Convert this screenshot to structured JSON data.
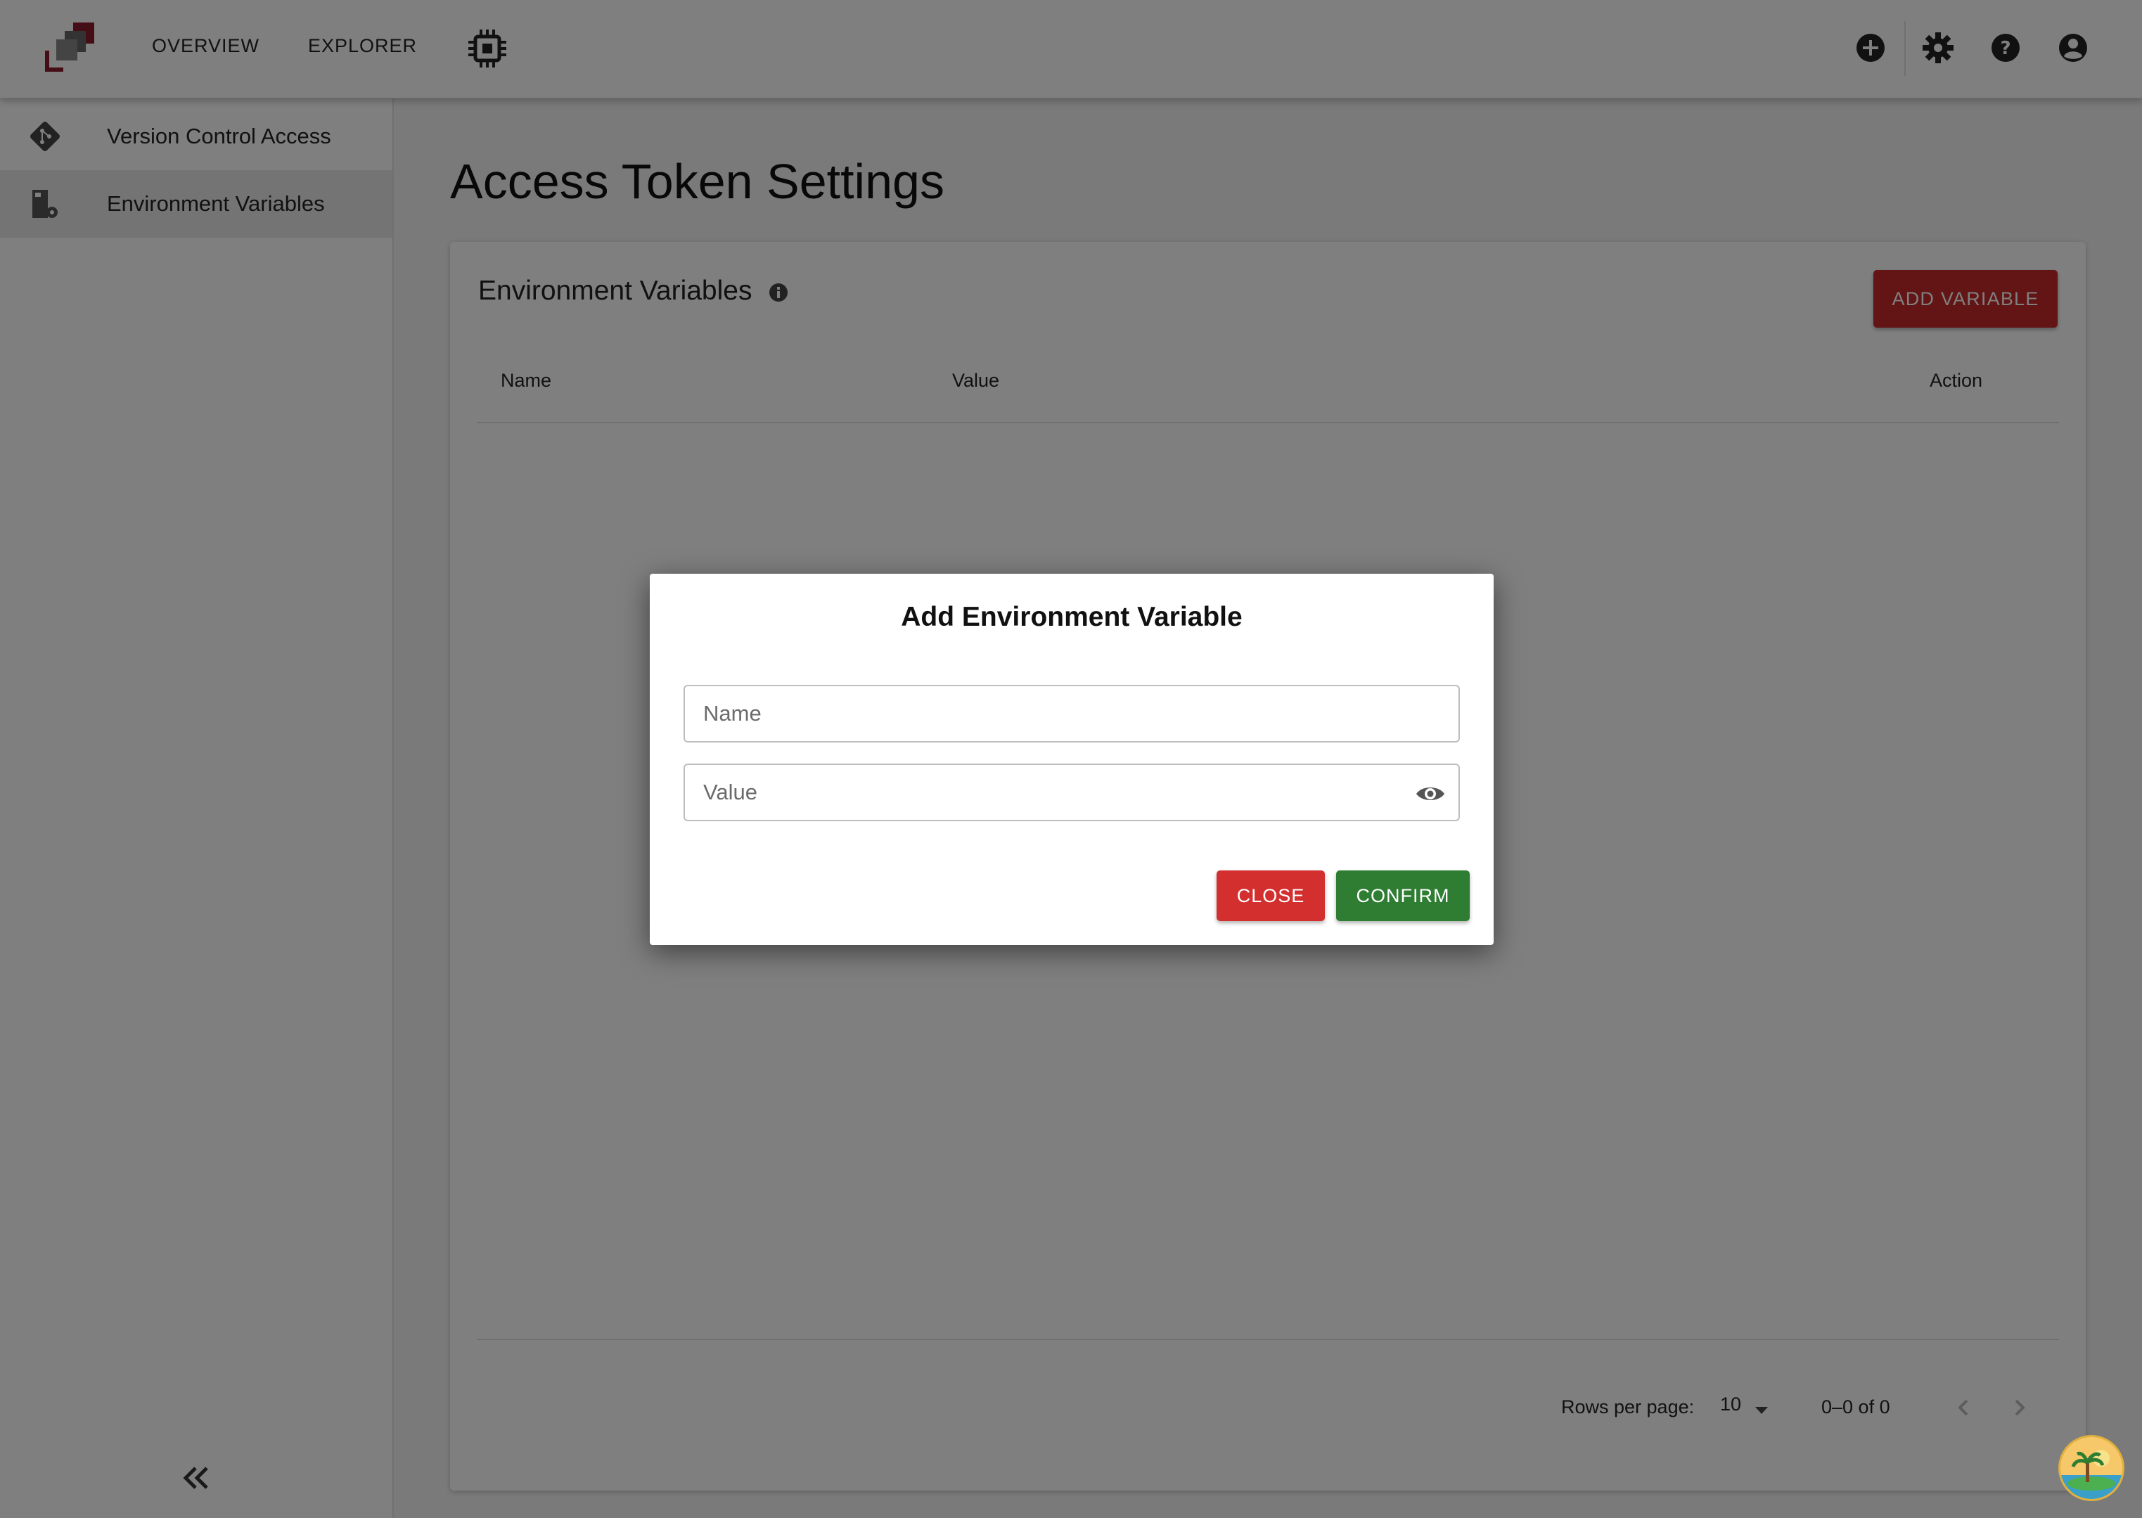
{
  "topbar": {
    "nav": [
      {
        "label": "OVERVIEW"
      },
      {
        "label": "EXPLORER"
      }
    ],
    "icons": [
      "add-circle-icon",
      "gear-icon",
      "help-icon",
      "account-icon"
    ],
    "colors": {
      "logo_primary": "#8b1a2c",
      "logo_secondary": "#555555"
    }
  },
  "sidebar": {
    "items": [
      {
        "label": "Version Control Access",
        "icon": "git-icon",
        "active": false
      },
      {
        "label": "Environment Variables",
        "icon": "env-settings-icon",
        "active": true
      }
    ],
    "collapse_icon": "double-chevron-left-icon"
  },
  "main": {
    "title": "Access Token Settings",
    "card": {
      "title": "Environment Variables",
      "add_button": "ADD VARIABLE",
      "columns": [
        "Name",
        "Value",
        "Action"
      ],
      "rows": [],
      "pagination": {
        "rows_per_page_label": "Rows per page:",
        "rows_per_page": "10",
        "range": "0–0 of 0"
      }
    }
  },
  "dialog": {
    "title": "Add Environment Variable",
    "name_placeholder": "Name",
    "value_placeholder": "Value",
    "close_label": "CLOSE",
    "confirm_label": "CONFIRM",
    "colors": {
      "close": "#d32f2f",
      "confirm": "#2e7d32",
      "add": "#c62828"
    }
  }
}
